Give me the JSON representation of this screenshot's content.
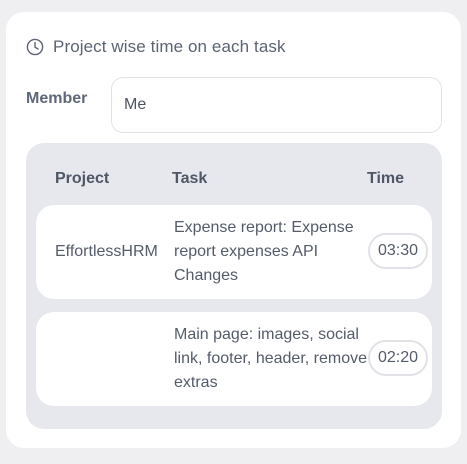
{
  "header": {
    "title": "Project wise time on each task",
    "icon": "clock-icon"
  },
  "member": {
    "label": "Member",
    "value": "Me"
  },
  "table": {
    "columns": [
      "Project",
      "Task",
      "Time"
    ],
    "rows": [
      {
        "project": "EffortlessHRM",
        "task": "Expense report: Expense report expenses API Changes",
        "time": "03:30"
      },
      {
        "project": "",
        "task": "Main page: images, social link, footer, header, remove extras",
        "time": "02:20"
      }
    ]
  }
}
